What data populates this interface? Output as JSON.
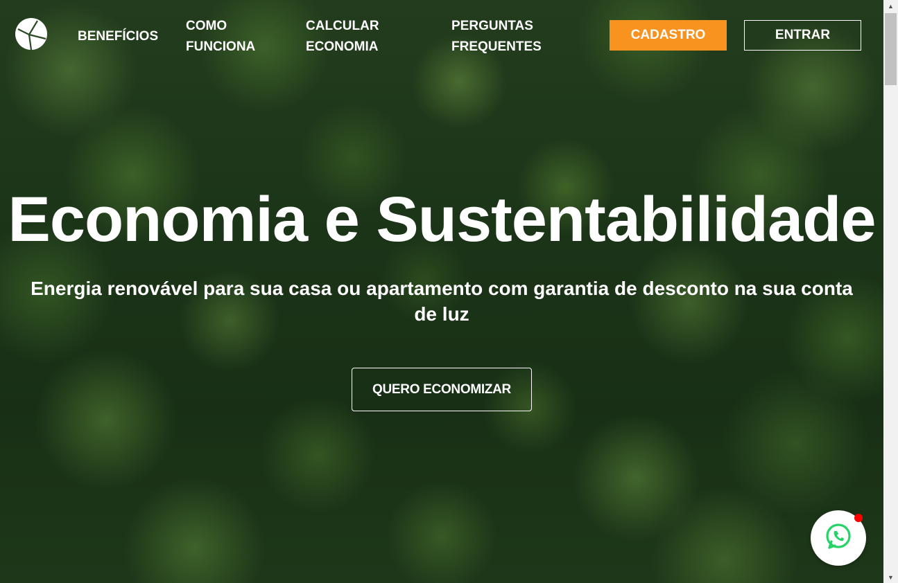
{
  "header": {
    "logo_icon": "leaf-logo-icon",
    "nav": {
      "beneficios": "BENEFÍCIOS",
      "como_funciona_line1": "COMO",
      "como_funciona_line2": "FUNCIONA",
      "calcular_line1": "CALCULAR",
      "calcular_line2": "ECONOMIA",
      "perguntas_line1": "PERGUNTAS",
      "perguntas_line2": "FREQUENTES"
    },
    "cadastro_label": "CADASTRO",
    "entrar_label": "ENTRAR"
  },
  "hero": {
    "title": "Economia e Sustentabilidade",
    "subtitle": "Energia renovável para sua casa ou apartamento com garantia de desconto na sua conta de luz",
    "cta_label": "QUERO ECONOMIZAR"
  },
  "floating": {
    "whatsapp_icon": "whatsapp-icon",
    "notification_color": "#ff0000"
  },
  "colors": {
    "accent_orange": "#f7931e",
    "text": "#ffffff"
  }
}
